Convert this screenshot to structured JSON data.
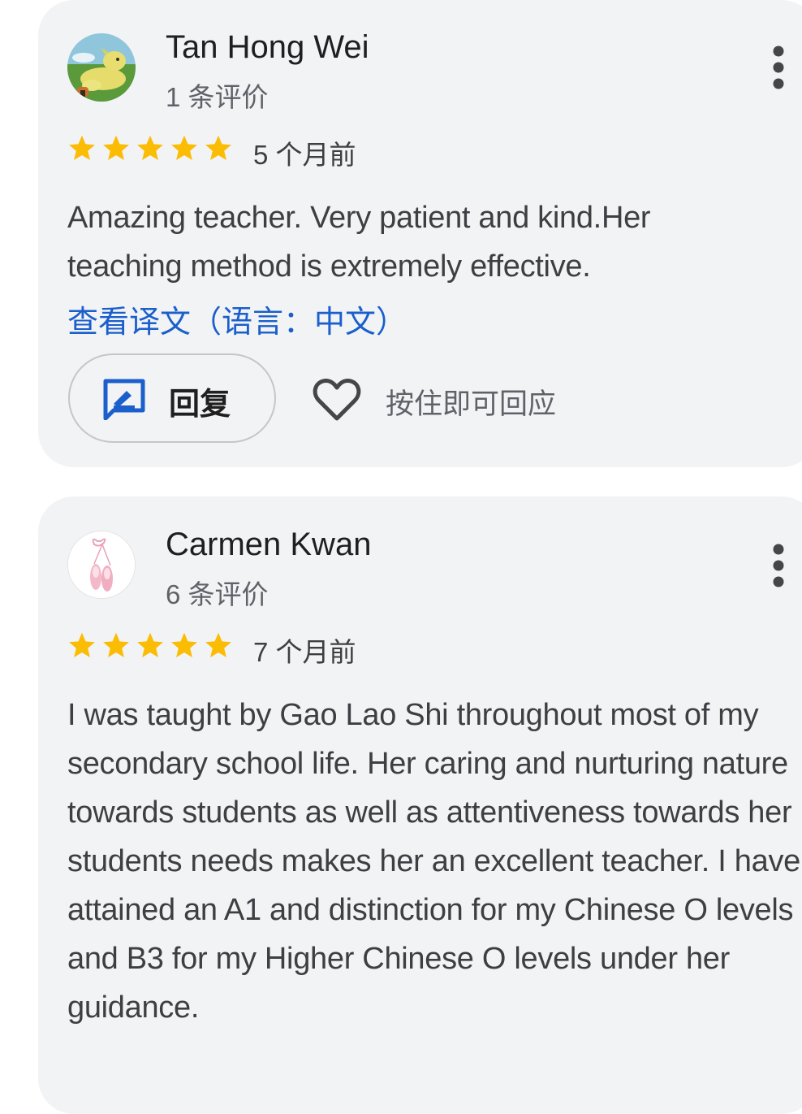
{
  "reviews": [
    {
      "author": "Tan Hong Wei",
      "review_count": "1 条评价",
      "rating": 5,
      "time_ago": "5 个月前",
      "text": "Amazing teacher. Very patient and kind.Her teaching method is extremely effective.",
      "translate_link": "查看译文（语言：中文）",
      "reply_label": "回复",
      "react_label": "按住即可回应",
      "avatar_icon": "dog-cartoon-avatar"
    },
    {
      "author": "Carmen Kwan",
      "review_count": "6 条评价",
      "rating": 5,
      "time_ago": "7 个月前",
      "text": "I was taught by Gao Lao Shi throughout most of my secondary school life. Her caring and nurturing nature towards students as well as attentiveness towards her students needs makes her an excellent teacher. I have attained an A1 and distinction for my Chinese O levels and B3 for my Higher Chinese O levels under her guidance.",
      "avatar_icon": "ballet-shoes-avatar"
    }
  ],
  "colors": {
    "star": "#fbbc04",
    "link": "#1a5fcb",
    "reply_icon": "#1a5fcb",
    "card_bg": "#f2f3f5"
  }
}
